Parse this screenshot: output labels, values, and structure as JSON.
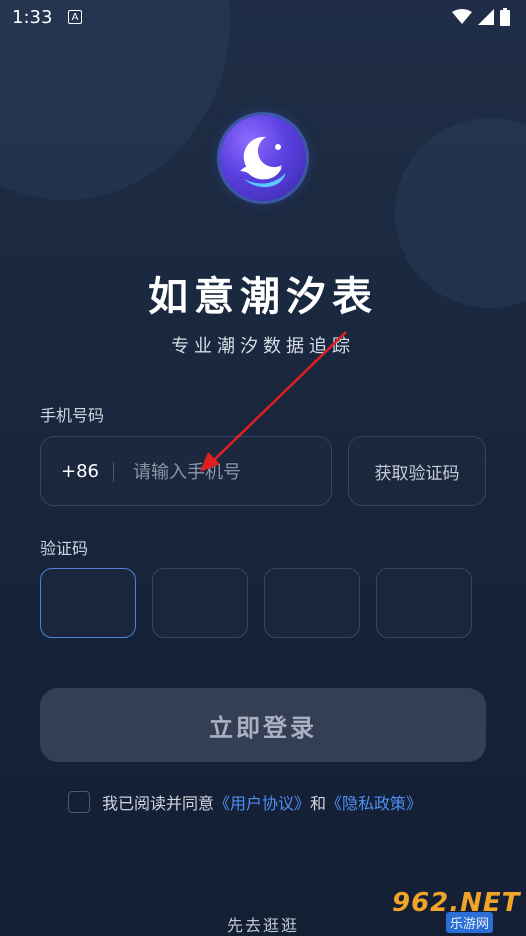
{
  "status_bar": {
    "time": "1:33",
    "indicator_letter": "A"
  },
  "app": {
    "title": "如意潮汐表",
    "subtitle": "专业潮汐数据追踪"
  },
  "phone": {
    "label": "手机号码",
    "country_code": "+86",
    "placeholder": "请输入手机号",
    "value": ""
  },
  "get_code_button": "获取验证码",
  "verification": {
    "label": "验证码",
    "cells": [
      "",
      "",
      "",
      ""
    ]
  },
  "login_button": "立即登录",
  "agreement": {
    "prefix": "我已阅读并同意",
    "user_agreement": "《用户协议》",
    "conjunction": "和",
    "privacy_policy": "《隐私政策》",
    "checked": false
  },
  "browse_link": "先去逛逛",
  "watermark": {
    "main": "962.NET",
    "sub": "乐游网"
  },
  "colors": {
    "background": "#1a283f",
    "accent_link": "#4d8ff0",
    "active_border": "#4f7fd6",
    "annotation_arrow": "#e02020"
  }
}
